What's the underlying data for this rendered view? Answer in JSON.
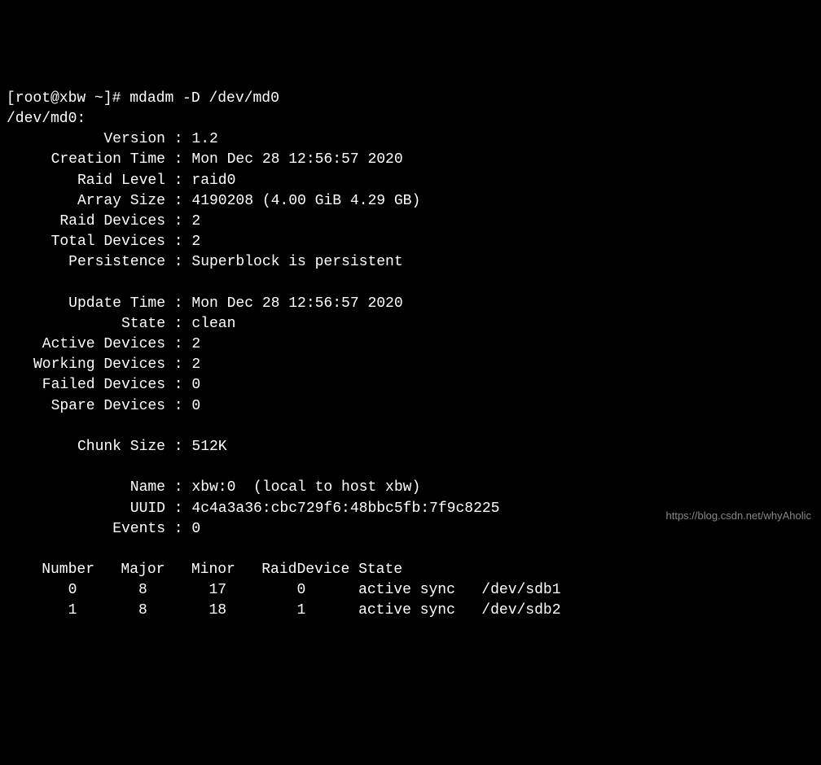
{
  "prompt": "[root@xbw ~]# ",
  "command": "mdadm -D /dev/md0",
  "device_line": "/dev/md0:",
  "fields": {
    "version": {
      "label": "Version",
      "value": "1.2"
    },
    "creation_time": {
      "label": "Creation Time",
      "value": "Mon Dec 28 12:56:57 2020"
    },
    "raid_level": {
      "label": "Raid Level",
      "value": "raid0"
    },
    "array_size": {
      "label": "Array Size",
      "value": "4190208 (4.00 GiB 4.29 GB)"
    },
    "raid_devices": {
      "label": "Raid Devices",
      "value": "2"
    },
    "total_devices": {
      "label": "Total Devices",
      "value": "2"
    },
    "persistence": {
      "label": "Persistence",
      "value": "Superblock is persistent"
    },
    "update_time": {
      "label": "Update Time",
      "value": "Mon Dec 28 12:56:57 2020"
    },
    "state": {
      "label": "State",
      "value": "clean"
    },
    "active_devices": {
      "label": "Active Devices",
      "value": "2"
    },
    "working_devices": {
      "label": "Working Devices",
      "value": "2"
    },
    "failed_devices": {
      "label": "Failed Devices",
      "value": "0"
    },
    "spare_devices": {
      "label": "Spare Devices",
      "value": "0"
    },
    "chunk_size": {
      "label": "Chunk Size",
      "value": "512K"
    },
    "name": {
      "label": "Name",
      "value": "xbw:0  (local to host xbw)"
    },
    "uuid": {
      "label": "UUID",
      "value": "4c4a3a36:cbc729f6:48bbc5fb:7f9c8225"
    },
    "events": {
      "label": "Events",
      "value": "0"
    }
  },
  "table": {
    "header": "    Number   Major   Minor   RaidDevice State",
    "rows": [
      "       0       8       17        0      active sync   /dev/sdb1",
      "       1       8       18        1      active sync   /dev/sdb2"
    ]
  },
  "watermark": "https://blog.csdn.net/whyAholic"
}
